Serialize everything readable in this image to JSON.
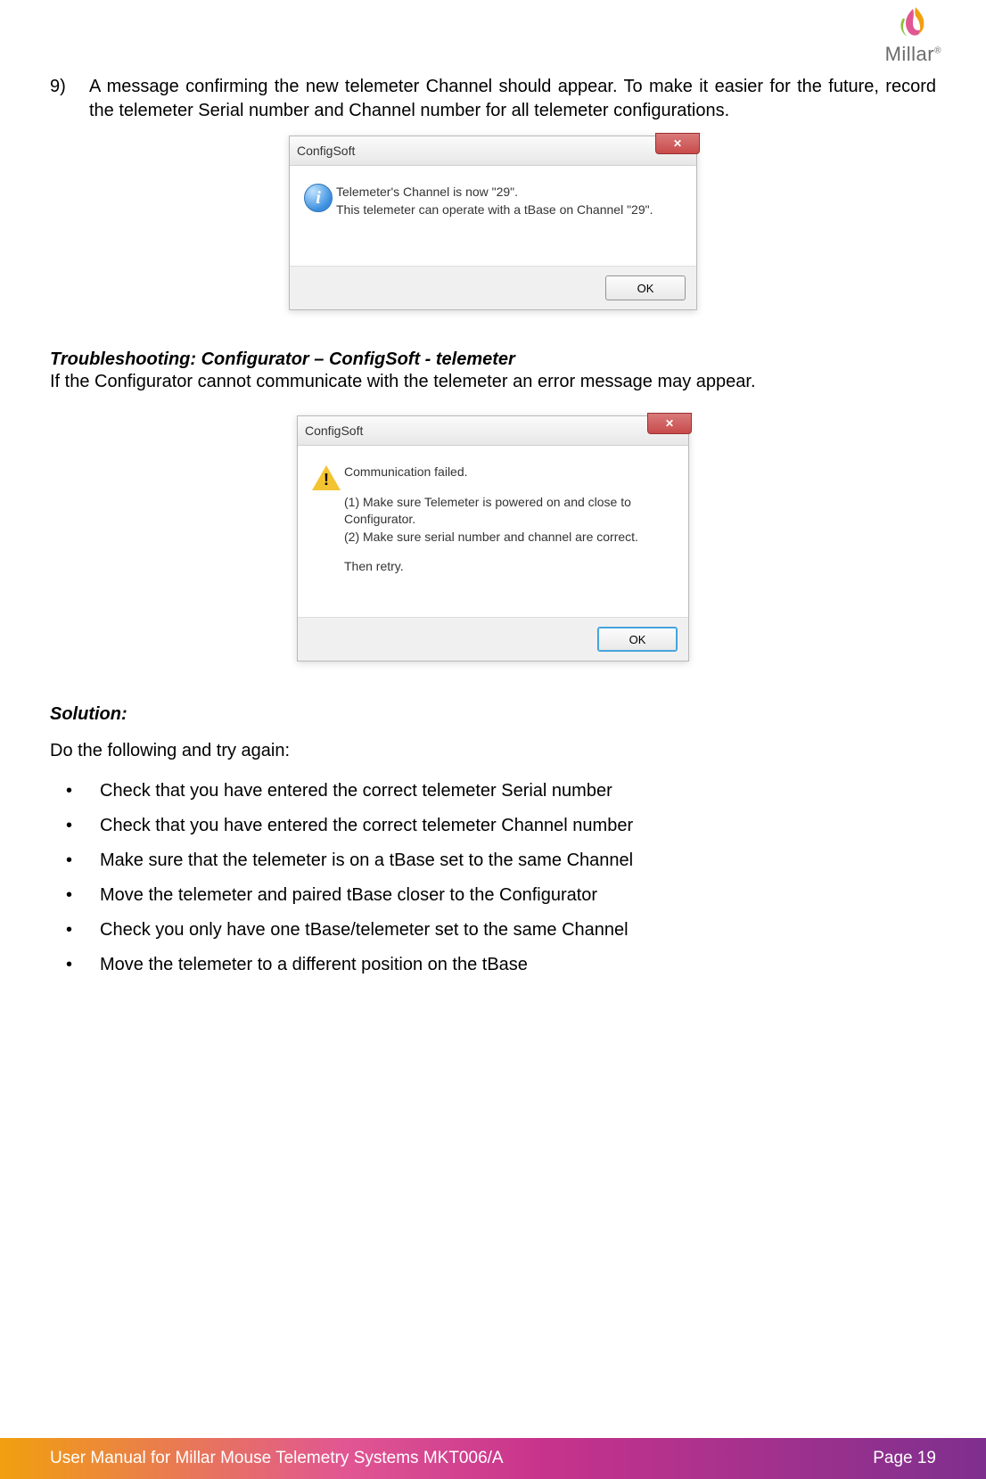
{
  "logo": {
    "text": "Millar"
  },
  "list9": {
    "number": "9)",
    "text": "A message confirming the new telemeter Channel should appear.  To make it easier for the future, record the telemeter Serial number and Channel number for all telemeter configurations."
  },
  "dialog1": {
    "title": "ConfigSoft",
    "line1": "Telemeter's Channel is now \"29\".",
    "line2": "This telemeter can operate with a tBase on Channel \"29\".",
    "ok": "OK"
  },
  "trouble": {
    "heading": "Troubleshooting: Configurator – ConfigSoft - telemeter",
    "text": "If the Configurator cannot communicate with the telemeter an error message may appear."
  },
  "dialog2": {
    "title": "ConfigSoft",
    "l1": "Communication failed.",
    "l2": "(1) Make sure Telemeter is powered on and close to Configurator.",
    "l3": "(2) Make sure serial number and channel are correct.",
    "l4": "Then retry.",
    "ok": "OK"
  },
  "solution": {
    "heading": "Solution:",
    "intro": "Do the following and try again:",
    "items": [
      "Check that you have entered the correct telemeter Serial number",
      "Check that you have entered the correct telemeter Channel number",
      "Make sure that the telemeter is on a tBase set to the same Channel",
      "Move the telemeter and paired tBase closer to the Configurator",
      "Check you only have one tBase/telemeter set to the same Channel",
      "Move the telemeter to a different position on the tBase"
    ]
  },
  "footer": {
    "left": "User Manual for Millar Mouse Telemetry Systems MKT006/A",
    "right": "Page 19"
  }
}
